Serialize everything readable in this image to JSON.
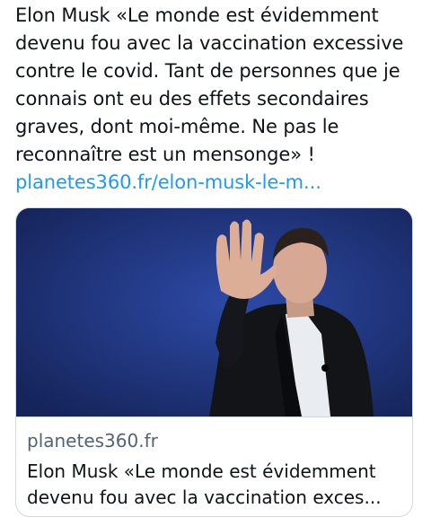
{
  "tweet": {
    "text_lines": [
      "Elon Musk «Le monde est évidemment",
      "devenu fou avec la vaccination excessive",
      "contre le covid. Tant de personnes que je",
      "connais ont eu des effets secondaires",
      "graves, dont moi-même. Ne pas le",
      "reconnaître est un mensonge» !"
    ],
    "link": "planetes360.fr/elon-musk-le-m..."
  },
  "card": {
    "domain": "planetes360.fr",
    "title_lines": [
      "Elon Musk «Le monde est évidemment",
      "devenu fou avec la vaccination exces..."
    ]
  },
  "colors": {
    "link": "#1d9bf0",
    "card_border": "#cfd9de",
    "muted_text": "#536471",
    "image_background": "#1e3a86"
  }
}
